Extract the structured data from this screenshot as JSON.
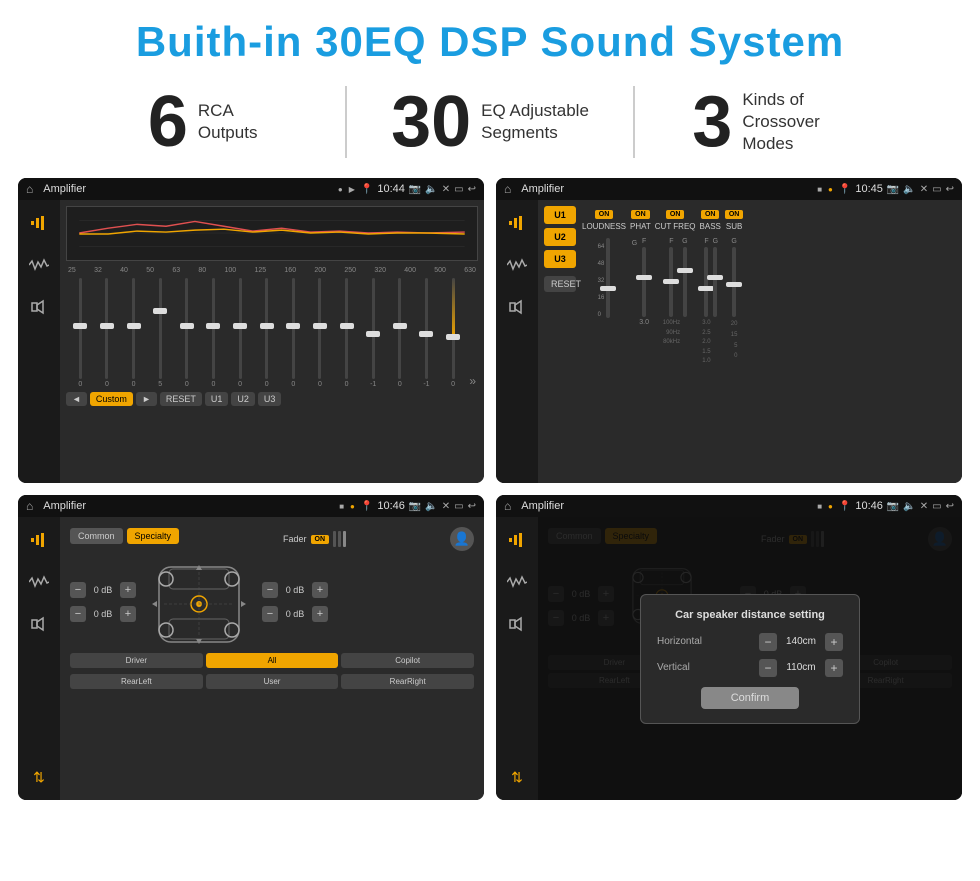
{
  "page": {
    "title": "Buith-in 30EQ DSP Sound System"
  },
  "stats": [
    {
      "number": "6",
      "label": "RCA\nOutputs"
    },
    {
      "number": "30",
      "label": "EQ Adjustable\nSegments"
    },
    {
      "number": "3",
      "label": "Kinds of\nCrossover Modes"
    }
  ],
  "screens": [
    {
      "id": "eq-screen",
      "statusBar": {
        "title": "Amplifier",
        "time": "10:44"
      }
    },
    {
      "id": "crossover-screen",
      "statusBar": {
        "title": "Amplifier",
        "time": "10:45"
      }
    },
    {
      "id": "fader-screen",
      "statusBar": {
        "title": "Amplifier",
        "time": "10:46"
      }
    },
    {
      "id": "distance-screen",
      "statusBar": {
        "title": "Amplifier",
        "time": "10:46"
      },
      "dialog": {
        "title": "Car speaker distance setting",
        "horizontal": {
          "label": "Horizontal",
          "value": "140cm"
        },
        "vertical": {
          "label": "Vertical",
          "value": "110cm"
        },
        "confirmLabel": "Confirm"
      }
    }
  ],
  "eqFreqs": [
    "25",
    "32",
    "40",
    "50",
    "63",
    "80",
    "100",
    "125",
    "160",
    "200",
    "250",
    "320",
    "400",
    "500",
    "630"
  ],
  "eqValues": [
    "0",
    "0",
    "0",
    "5",
    "0",
    "0",
    "0",
    "0",
    "0",
    "0",
    "0",
    "-1",
    "0",
    "-1"
  ],
  "eqModes": {
    "custom": "Custom",
    "reset": "RESET",
    "u1": "U1",
    "u2": "U2",
    "u3": "U3"
  },
  "crossoverPresets": [
    "U1",
    "U2",
    "U3"
  ],
  "crossoverControls": [
    {
      "label": "LOUDNESS",
      "on": true,
      "value": ""
    },
    {
      "label": "PHAT",
      "on": true,
      "value": ""
    },
    {
      "label": "CUT FREQ",
      "on": true,
      "value": ""
    },
    {
      "label": "BASS",
      "on": true,
      "value": ""
    },
    {
      "label": "SUB",
      "on": true,
      "value": ""
    }
  ],
  "fader": {
    "modes": [
      "Common",
      "Specialty"
    ],
    "activeMode": "Specialty",
    "faderLabel": "Fader",
    "faderOn": "ON",
    "volValues": [
      "0 dB",
      "0 dB",
      "0 dB",
      "0 dB"
    ],
    "buttons": {
      "driver": "Driver",
      "all": "All",
      "copilot": "Copilot",
      "rearLeft": "RearLeft",
      "user": "User",
      "rearRight": "RearRight"
    }
  },
  "distanceDialog": {
    "title": "Car speaker distance setting",
    "horizontalLabel": "Horizontal",
    "horizontalValue": "140cm",
    "verticalLabel": "Vertical",
    "verticalValue": "110cm",
    "confirmLabel": "Confirm",
    "fader": {
      "modes": [
        "Common",
        "Specialty"
      ],
      "faderLabel": "Fader",
      "faderOn": "ON"
    }
  }
}
